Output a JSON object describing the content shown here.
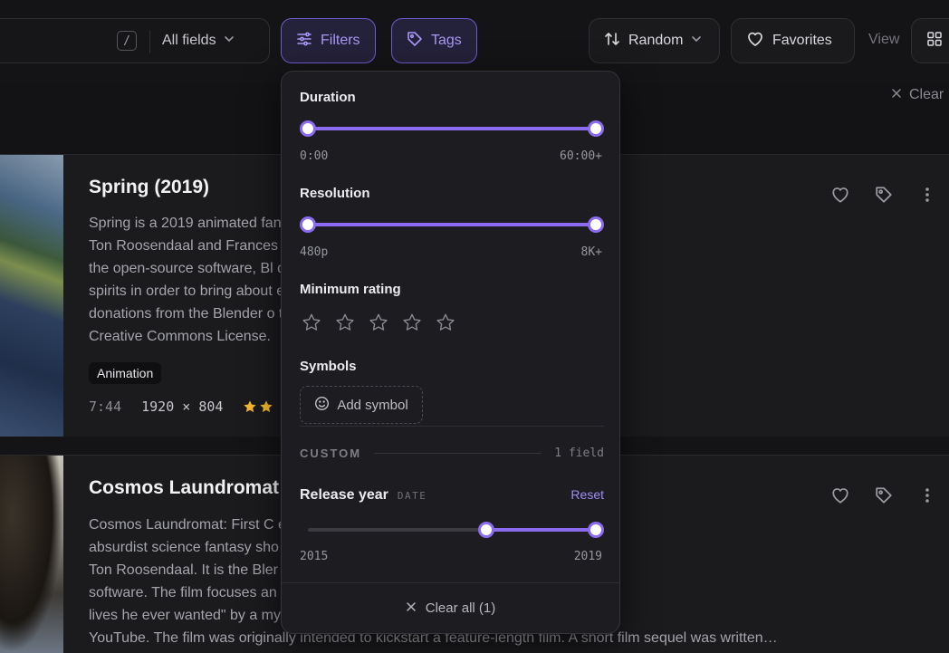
{
  "toolbar": {
    "search_shortcut": "/",
    "fields_label": "All fields",
    "filters_label": "Filters",
    "tags_label": "Tags",
    "sort_label": "Random",
    "favorites_label": "Favorites",
    "view_label": "View",
    "clear_label": "Clear"
  },
  "cards": [
    {
      "title": "Spring (2019)",
      "description": "Spring is a 2019 animated fan                                                       oralczyk and produced by\nTon Roosendaal and Frances                                                       vie\", and was made utilizing\nthe open-source software, Bl                                                       dog confronting ancient\nspirits in order to bring about                                                      e Blender Foundation, with\ndonations from the Blender o                                                       tudio was released under a\nCreative Commons License.",
      "tag": "Animation",
      "duration": "7:44",
      "resolution": "1920 × 804",
      "rating": 2
    },
    {
      "title": "Cosmos Laundromat",
      "description": "Cosmos Laundromat: First C                                                       eberry, is 2015 animated\nabsurdist science fantasy sho                                                      er Wouda, and produced by\nTon Roosendaal. It is the Bler                                                       made utilizing the Blender\nsoftware. The film focuses an                                                      k who is offered \"all the\nlives he ever wanted\" by a my                                                       015, it was released to\nYouTube. The film was originally intended to kickstart a feature-length film. A short film sequel was written…"
    }
  ],
  "filters": {
    "duration": {
      "title": "Duration",
      "min_label": "0:00",
      "max_label": "60:00+",
      "low": 0.0,
      "high": 1.0
    },
    "resolution": {
      "title": "Resolution",
      "min_label": "480p",
      "max_label": "8K+",
      "low": 0.0,
      "high": 1.0
    },
    "rating": {
      "title": "Minimum rating",
      "value": 0,
      "max": 5
    },
    "symbols": {
      "title": "Symbols",
      "add_label": "Add symbol"
    },
    "custom": {
      "label": "CUSTOM",
      "count": "1 field"
    },
    "release_year": {
      "title": "Release year",
      "type": "DATE",
      "reset_label": "Reset",
      "min_label": "2015",
      "max_label": "2019",
      "low": 0.62,
      "high": 1.0
    },
    "clear_all_label": "Clear all (1)"
  },
  "colors": {
    "accent": "#8b6cf0",
    "star": "#f5b82e",
    "background": "#141416",
    "card": "#1b1b1e"
  }
}
